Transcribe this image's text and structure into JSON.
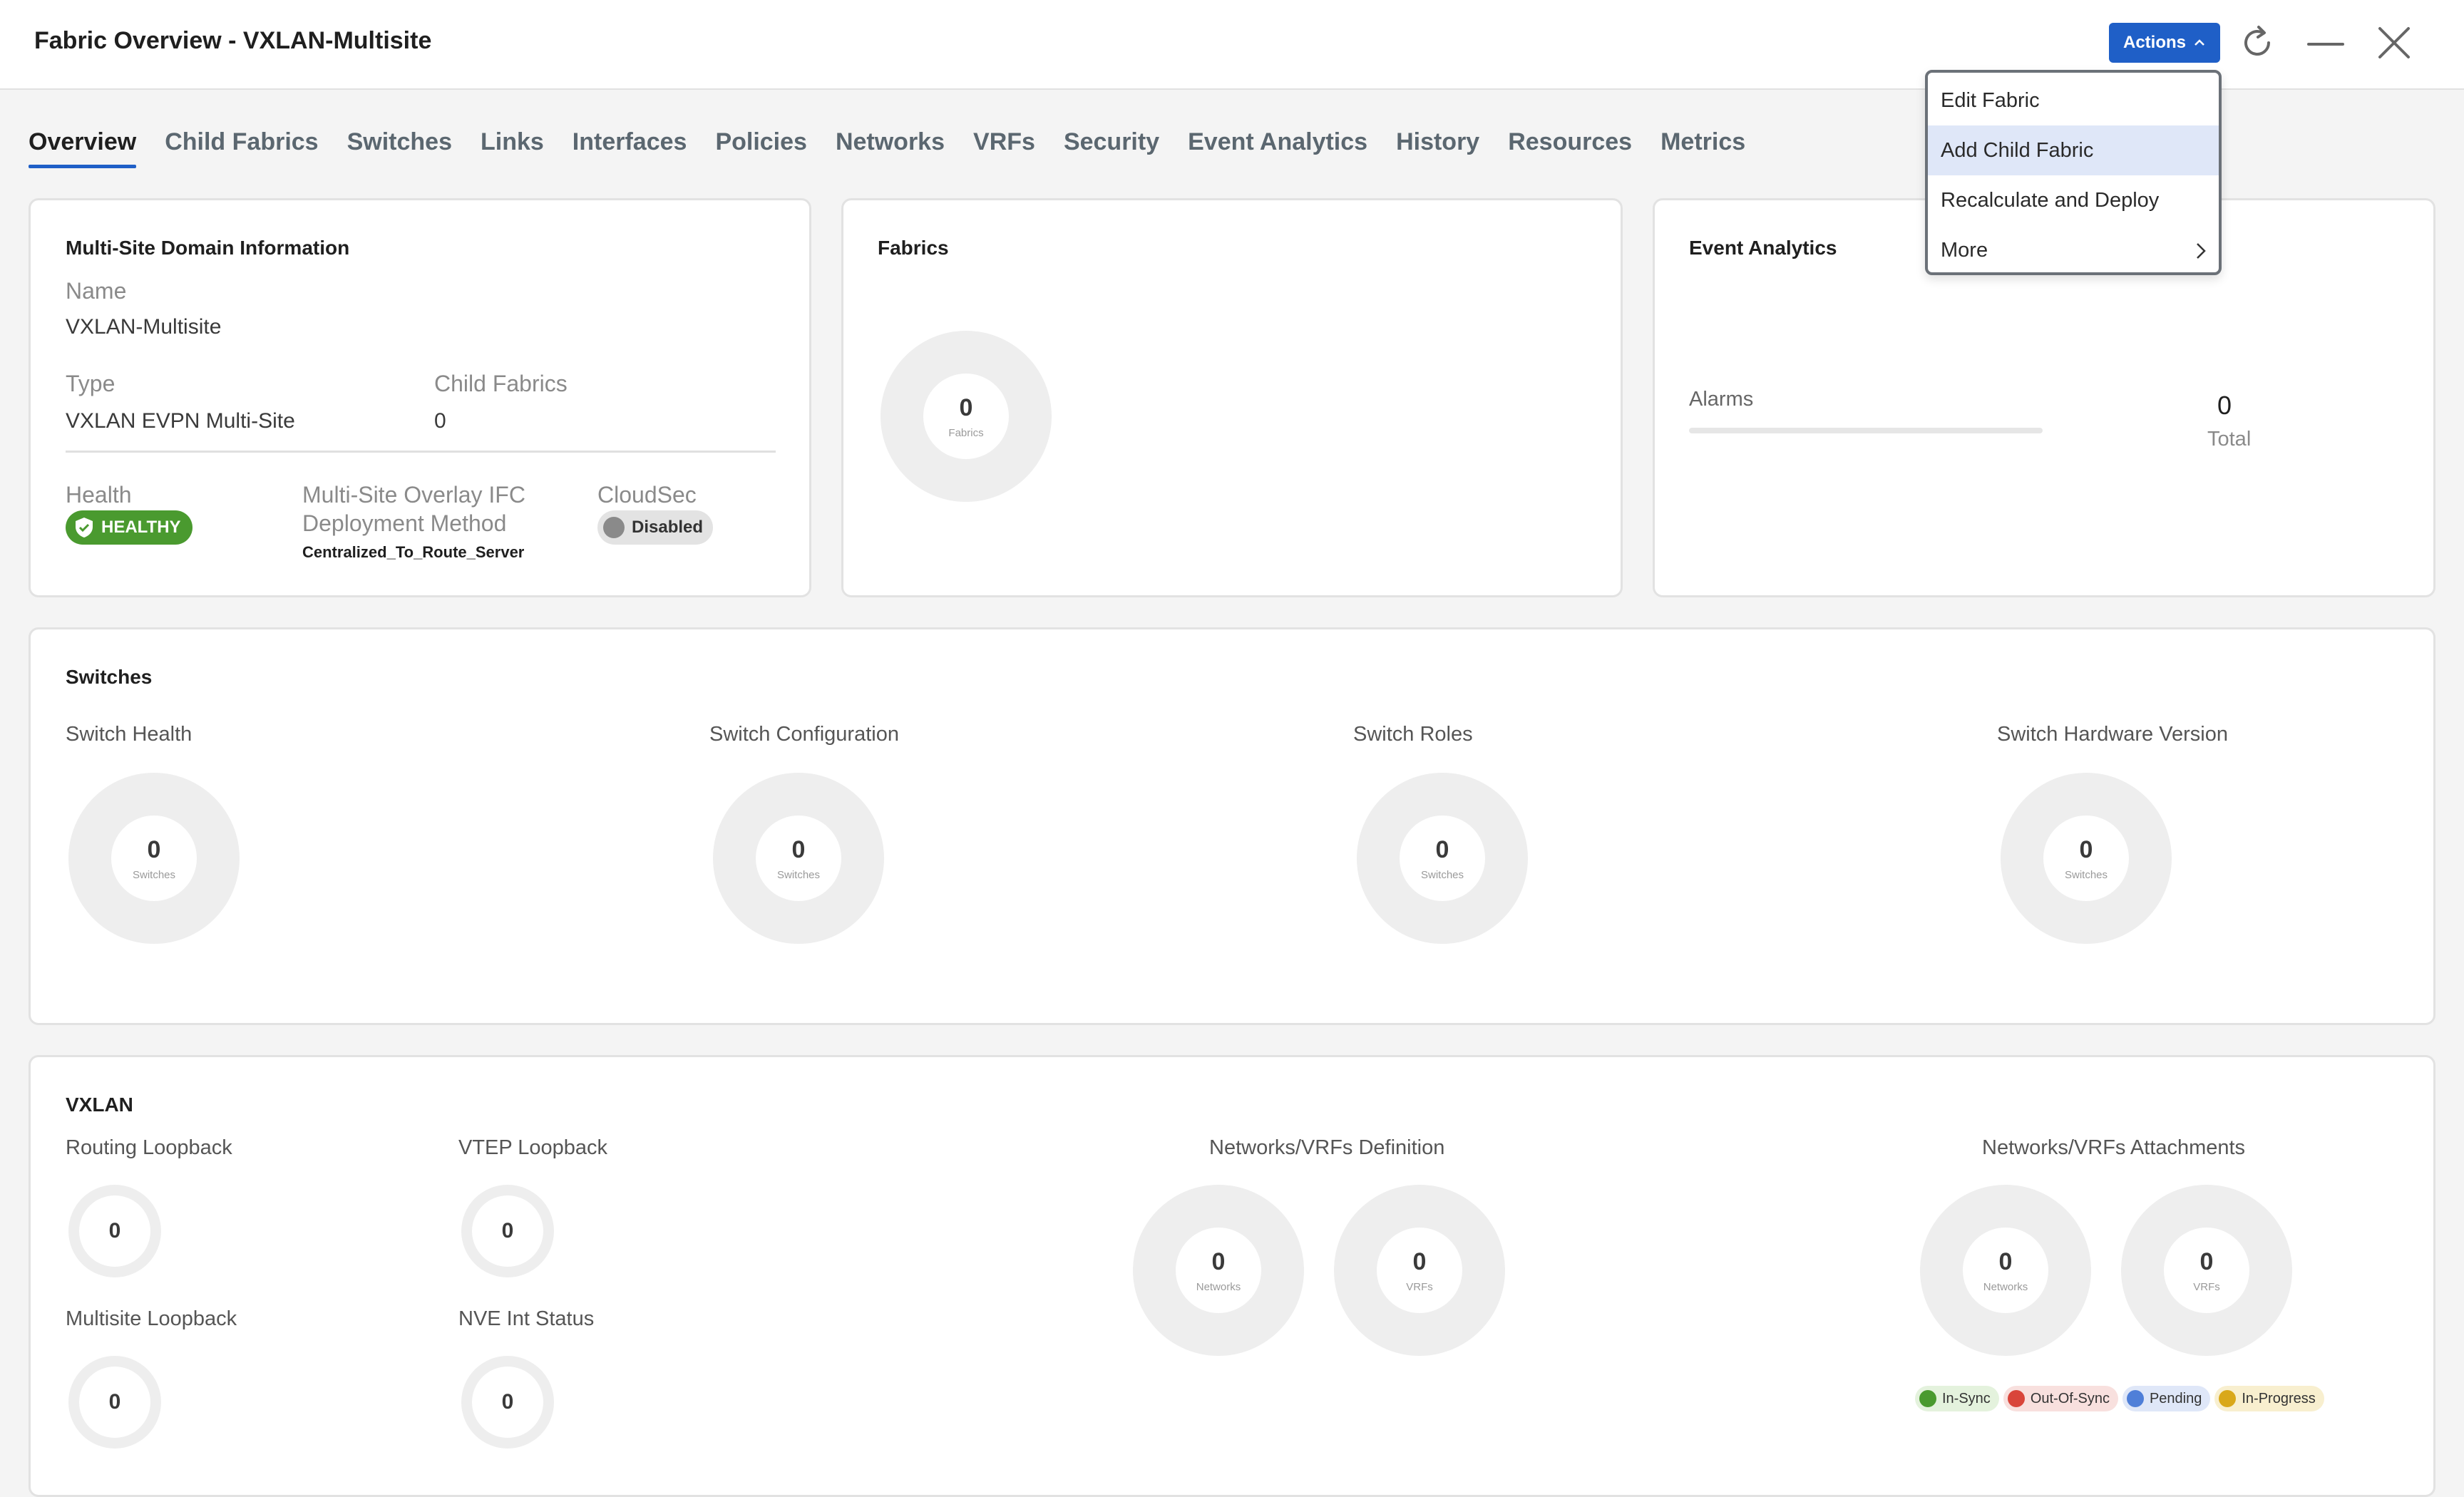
{
  "header": {
    "title": "Fabric Overview - VXLAN-Multisite",
    "actions_label": "Actions"
  },
  "tabs": [
    "Overview",
    "Child Fabrics",
    "Switches",
    "Links",
    "Interfaces",
    "Policies",
    "Networks",
    "VRFs",
    "Security",
    "Event Analytics",
    "History",
    "Resources",
    "Metrics"
  ],
  "actions_menu": [
    "Edit Fabric",
    "Add Child Fabric",
    "Recalculate and Deploy",
    "More"
  ],
  "multisite_card": {
    "title": "Multi-Site Domain Information",
    "name_label": "Name",
    "name_value": "VXLAN-Multisite",
    "type_label": "Type",
    "type_value": "VXLAN EVPN Multi-Site",
    "child_fabrics_label": "Child Fabrics",
    "child_fabrics_value": "0",
    "health_label": "Health",
    "health_value": "HEALTHY",
    "overlay_label_1": "Multi-Site Overlay IFC",
    "overlay_label_2": "Deployment Method",
    "overlay_value": "Centralized_To_Route_Server",
    "cloudsec_label": "CloudSec",
    "cloudsec_value": "Disabled"
  },
  "fabrics_card": {
    "title": "Fabrics",
    "count": "0",
    "unit": "Fabrics"
  },
  "event_card": {
    "title": "Event Analytics",
    "alarms_label": "Alarms",
    "total_value": "0",
    "total_label": "Total"
  },
  "switches_card": {
    "title": "Switches",
    "charts": [
      {
        "label": "Switch Health",
        "count": "0",
        "unit": "Switches"
      },
      {
        "label": "Switch Configuration",
        "count": "0",
        "unit": "Switches"
      },
      {
        "label": "Switch Roles",
        "count": "0",
        "unit": "Switches"
      },
      {
        "label": "Switch Hardware Version",
        "count": "0",
        "unit": "Switches"
      }
    ]
  },
  "vxlan_card": {
    "title": "VXLAN",
    "routing_loopback": {
      "label": "Routing Loopback",
      "count": "0"
    },
    "vtep_loopback": {
      "label": "VTEP Loopback",
      "count": "0"
    },
    "multisite_loopback": {
      "label": "Multisite Loopback",
      "count": "0"
    },
    "nve_status": {
      "label": "NVE Int Status",
      "count": "0"
    },
    "definition": {
      "label": "Networks/VRFs Definition",
      "networks": "0",
      "networks_unit": "Networks",
      "vrfs": "0",
      "vrfs_unit": "VRFs"
    },
    "attachments": {
      "label": "Networks/VRFs Attachments",
      "networks": "0",
      "networks_unit": "Networks",
      "vrfs": "0",
      "vrfs_unit": "VRFs"
    },
    "legend": [
      {
        "label": "In-Sync",
        "color": "#4a9a2f",
        "bg": "#e4f2dd"
      },
      {
        "label": "Out-Of-Sync",
        "color": "#d9453a",
        "bg": "#f8e0de"
      },
      {
        "label": "Pending",
        "color": "#4f7fd8",
        "bg": "#dfe7f8"
      },
      {
        "label": "In-Progress",
        "color": "#d9a81a",
        "bg": "#f8efcf"
      }
    ]
  }
}
